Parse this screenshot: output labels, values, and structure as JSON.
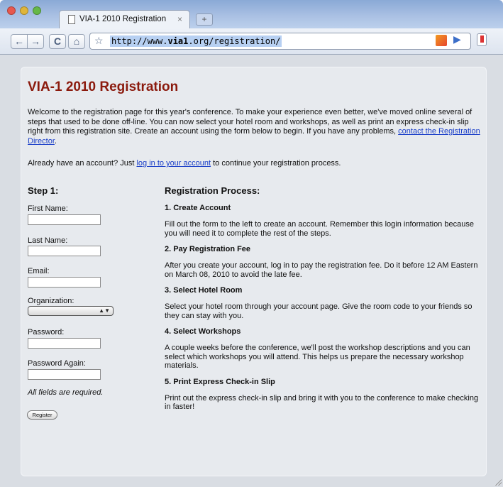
{
  "browser": {
    "tab_title": "VIA-1 2010 Registration",
    "tab_close": "×",
    "new_tab": "+",
    "url_prefix": "http://www.",
    "url_host": "via1",
    "url_suffix": ".org/registration/",
    "back_glyph": "←",
    "forward_glyph": "→",
    "reload_glyph": "C",
    "home_glyph": "⌂",
    "star_glyph": "☆",
    "play_glyph": "▶"
  },
  "page": {
    "title": "VIA-1 2010 Registration",
    "intro_text": "Welcome to the registration page for this year's conference. To make your experience even better, we've moved online several of steps that used to be done off-line. You can now select your hotel room and workshops, as well as print an express check-in slip right from this registration site. Create an account using the form below to begin. If you have any problems, ",
    "intro_link": "contact the Registration Director",
    "intro_end": ".",
    "have_account_text": "Already have an account? Just ",
    "login_link": "log in to your account",
    "have_account_end": " to continue your registration process."
  },
  "form": {
    "heading": "Step 1:",
    "first_name_label": "First Name:",
    "last_name_label": "Last Name:",
    "email_label": "Email:",
    "organization_label": "Organization:",
    "organization_value": "",
    "password_label": "Password:",
    "password_again_label": "Password Again:",
    "required_note": "All fields are required.",
    "register_button": "Register"
  },
  "process": {
    "heading": "Registration Process:",
    "steps": [
      {
        "title": "1. Create Account",
        "text": "Fill out the form to the left to create an account. Remember this login information because you will need it to complete the rest of the steps."
      },
      {
        "title": "2. Pay Registration Fee",
        "text": "After you create your account, log in to pay the registration fee. Do it before 12 AM Eastern on March 08, 2010 to avoid the late fee."
      },
      {
        "title": "3. Select Hotel Room",
        "text": "Select your hotel room through your account page. Give the room code to your friends so they can stay with you."
      },
      {
        "title": "4. Select Workshops",
        "text": "A couple weeks before the conference, we'll post the workshop descriptions and you can select which workshops you will attend. This helps us prepare the necessary workshop materials."
      },
      {
        "title": "5. Print Express Check-in Slip",
        "text": "Print out the express check-in slip and bring it with you to the conference to make checking in faster!"
      }
    ]
  }
}
